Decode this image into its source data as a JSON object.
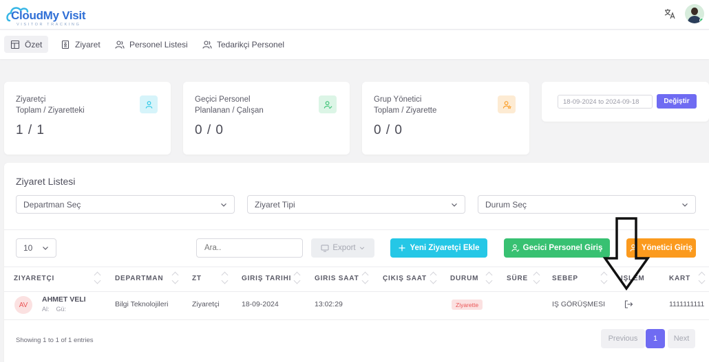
{
  "app": {
    "logo_main": "CloudMy Visit",
    "logo_sub": "VISITOR TRACKING",
    "accent": "#6f6bf2"
  },
  "nav": {
    "items": [
      {
        "label": "Özet",
        "icon": "layout-icon",
        "active": true
      },
      {
        "label": "Ziyaret",
        "icon": "badge-icon"
      },
      {
        "label": "Personel Listesi",
        "icon": "users-icon"
      },
      {
        "label": "Tedarikçi Personel",
        "icon": "users-icon"
      }
    ]
  },
  "stats": [
    {
      "line1": "Ziyaretçi",
      "line2": "Toplam / Ziyaretteki",
      "value": "1 / 1",
      "icon": "user-icon",
      "color": "#25c7e6"
    },
    {
      "line1": "Geçici Personel",
      "line2": "Planlanan / Çalışan",
      "value": "0 / 0",
      "icon": "user-check-icon",
      "color": "#38c172"
    },
    {
      "line1": "Grup Yönetici",
      "line2": "Toplam / Ziyarette",
      "value": "0 / 0",
      "icon": "user-star-icon",
      "color": "#fb9a1e"
    }
  ],
  "date_filter": {
    "value": "18-09-2024 to 2024-09-18",
    "button": "Değiştir"
  },
  "list": {
    "title": "Ziyaret Listesi",
    "filters": [
      "Departman Seç",
      "Ziyaret Tipi",
      "Durum Seç"
    ],
    "per_page": "10",
    "search_placeholder": "Ara..",
    "export_label": "Export",
    "add_visitor": "Yeni Ziyaretçi Ekle",
    "temp_login": "Gecici Personel Giriş",
    "manager_login": "Yönetici Giriş",
    "columns": [
      "ZIYARETÇI",
      "DEPARTMAN",
      "ZT",
      "GIRIŞ TARIHI",
      "GIRIS SAAT",
      "ÇIKIŞ SAAT",
      "DURUM",
      "SÜRE",
      "SEBEP",
      "IŞLEM",
      "KART"
    ],
    "rows": [
      {
        "initials": "AV",
        "name": "AHMET VELI",
        "sub1": "Al:",
        "sub2": "Gü:",
        "department": "Bilgi Teknolojileri",
        "type": "Ziyaretçi",
        "entry_date": "18-09-2024",
        "entry_time": "13:02:29",
        "exit_time": "",
        "status": "Ziyarette",
        "duration": "",
        "reason": "IŞ GÖRÜŞMESI",
        "action_icon": "exit-icon",
        "card": "1111111111"
      }
    ],
    "showing": "Showing 1 to 1 of 1 entries",
    "pagination": {
      "prev": "Previous",
      "current": "1",
      "next": "Next"
    }
  }
}
